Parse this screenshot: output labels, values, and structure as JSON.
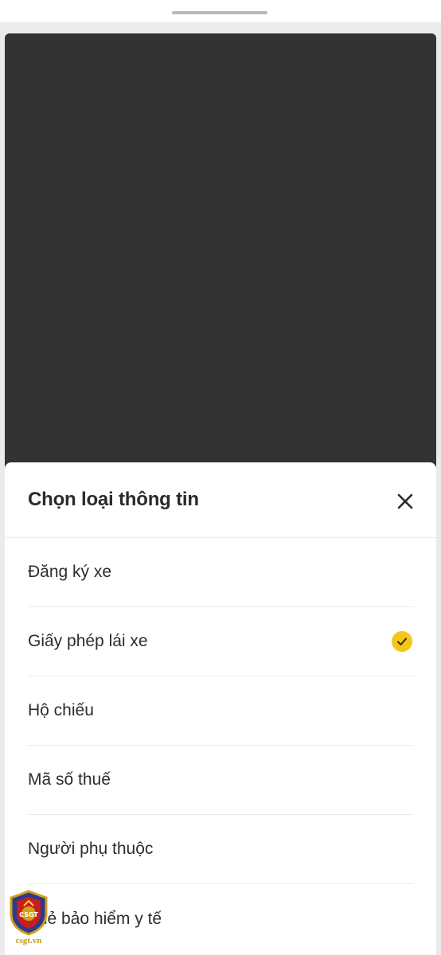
{
  "sheet": {
    "title": "Chọn loại thông tin",
    "close_icon": "close-icon"
  },
  "options": [
    {
      "label": "Đăng ký xe",
      "selected": false
    },
    {
      "label": "Giấy phép lái xe",
      "selected": true
    },
    {
      "label": "Hộ chiếu",
      "selected": false
    },
    {
      "label": "Mã số thuế",
      "selected": false
    },
    {
      "label": "Người phụ thuộc",
      "selected": false
    },
    {
      "label": "Thẻ bảo hiểm y tế",
      "selected": false
    }
  ],
  "colors": {
    "backdrop": "#333333",
    "accent_check": "#f5c518",
    "title_text": "#2d2a27"
  },
  "watermark": {
    "text": "csgt.vn",
    "badge": "CSGT"
  }
}
